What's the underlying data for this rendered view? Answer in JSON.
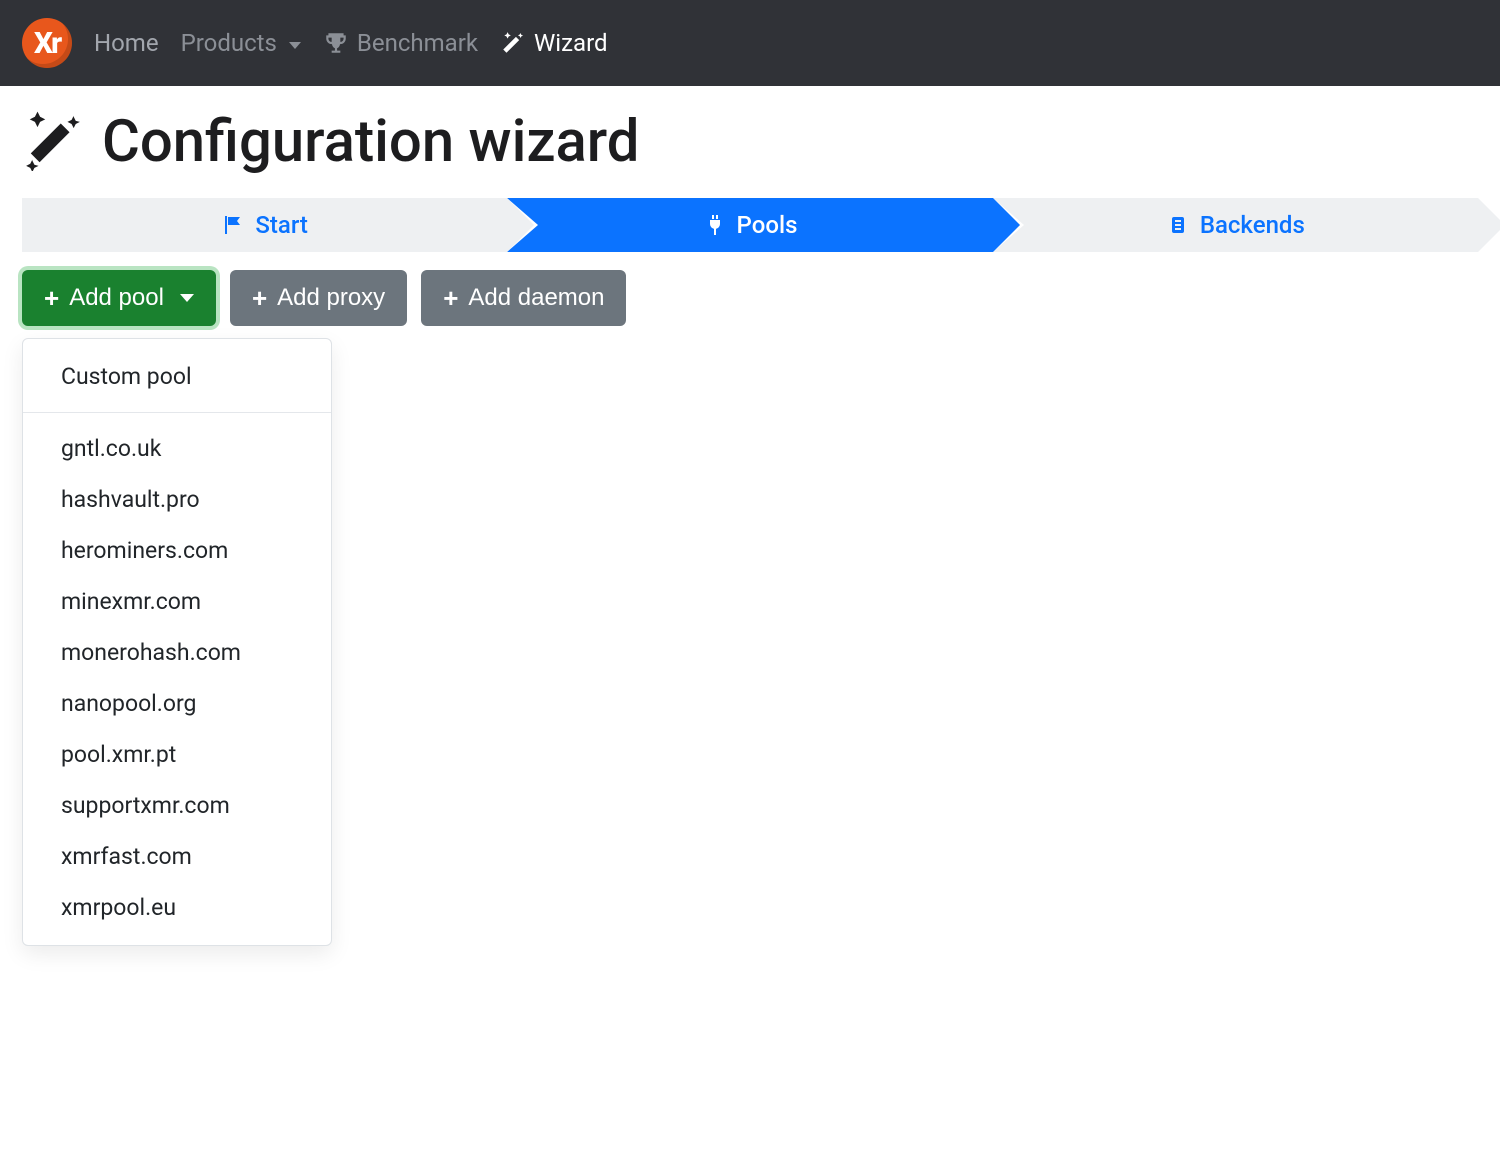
{
  "nav": {
    "logo": "Xr",
    "items": [
      {
        "label": "Home",
        "active": false
      },
      {
        "label": "Products",
        "active": false,
        "hasCaret": true
      },
      {
        "label": "Benchmark",
        "active": false,
        "icon": "trophy"
      },
      {
        "label": "Wizard",
        "active": true,
        "icon": "wand"
      }
    ]
  },
  "page": {
    "title": "Configuration wizard"
  },
  "steps": [
    {
      "label": "Start",
      "icon": "flag",
      "active": false
    },
    {
      "label": "Pools",
      "icon": "plug",
      "active": true
    },
    {
      "label": "Backends",
      "icon": "chip",
      "active": false
    }
  ],
  "toolbar": {
    "addPool": "Add pool",
    "addProxy": "Add proxy",
    "addDaemon": "Add daemon"
  },
  "dropdown": {
    "custom": "Custom pool",
    "pools": [
      "gntl.co.uk",
      "hashvault.pro",
      "herominers.com",
      "minexmr.com",
      "monerohash.com",
      "nanopool.org",
      "pool.xmr.pt",
      "supportxmr.com",
      "xmrfast.com",
      "xmrpool.eu"
    ]
  }
}
